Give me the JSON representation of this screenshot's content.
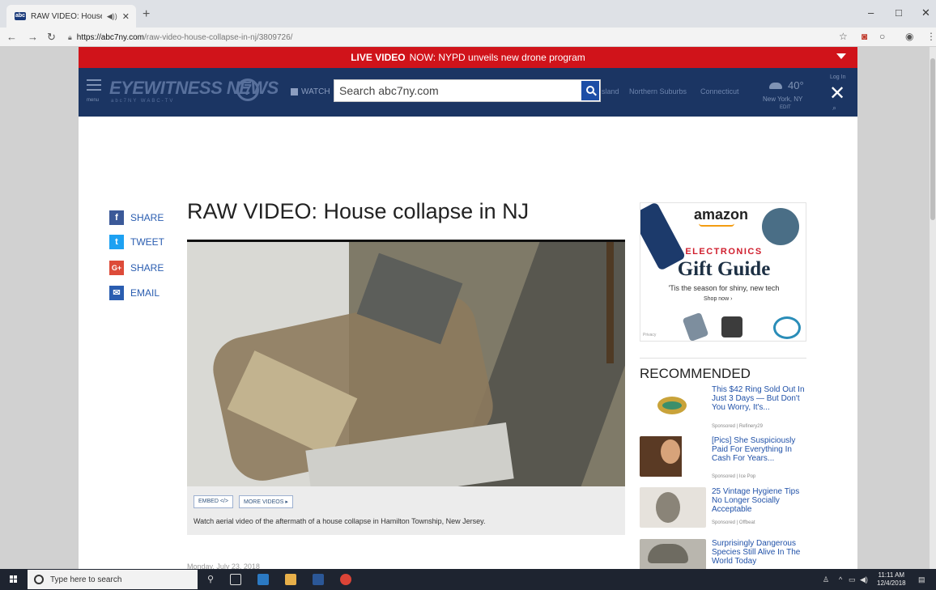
{
  "browser": {
    "tab_title": "RAW VIDEO: House collapse",
    "tab_audio": "◀))",
    "new_tab": "+",
    "url_host": "https://abc7ny.com",
    "url_path": "/raw-video-house-collapse-in-nj/3809726/",
    "window_controls": [
      "–",
      "□",
      "✕"
    ]
  },
  "live_bar": {
    "label": "LIVE VIDEO",
    "headline": "NOW: NYPD unveils new drone program",
    "color": "#d0131a"
  },
  "header": {
    "menu_label": "menu",
    "logo": "EYEWITNESS NEWS",
    "logo_badge": "7",
    "logo_sub": "abc7NY  WABC-TV",
    "watch_label": "WATCH",
    "search_placeholder": "Search abc7ny.com",
    "nav_links": [
      "sland",
      "Northern Suburbs",
      "Connecticut"
    ],
    "weather_temp": "40°",
    "weather_city": "New York, NY",
    "weather_edit": "EDIT",
    "login": "Log In",
    "color": "#1b3563"
  },
  "share": {
    "items": [
      {
        "label": "SHARE",
        "icon": "f",
        "color": "#3b5998"
      },
      {
        "label": "TWEET",
        "icon": "t",
        "color": "#1da1f2"
      },
      {
        "label": "SHARE",
        "icon": "G+",
        "color": "#dd4b39"
      },
      {
        "label": "EMAIL",
        "icon": "✉",
        "color": "#2a5db0"
      }
    ]
  },
  "article": {
    "title": "RAW VIDEO: House collapse in NJ",
    "embed_label": "EMBED </>",
    "more_videos_label": "MORE VIDEOS ▸",
    "caption": "Watch aerial video of the aftermath of a house collapse in Hamilton Township, New Jersey.",
    "date": "Monday, July 23, 2018"
  },
  "ad": {
    "brand": "amazon",
    "category": "ELECTRONICS",
    "headline": "Gift Guide",
    "subline": "'Tis the season for shiny, new tech",
    "cta": "Shop now ›",
    "privacy": "Privacy"
  },
  "recommended": {
    "title": "RECOMMENDED",
    "items": [
      {
        "text": "This $42 Ring Sold Out In Just 3 Days — But Don't You Worry, It's...",
        "sponsor": "Sponsored | Refinery29"
      },
      {
        "text": "[Pics] She Suspiciously Paid For Everything In Cash For Years...",
        "sponsor": "Sponsored | Ice Pop"
      },
      {
        "text": "25 Vintage Hygiene Tips No Longer Socially Acceptable",
        "sponsor": "Sponsored | Offbeat"
      },
      {
        "text": "Surprisingly Dangerous Species Still Alive In The World Today",
        "sponsor": ""
      }
    ]
  },
  "taskbar": {
    "search_placeholder": "Type here to search",
    "time": "11:11 AM",
    "date": "12/4/2018"
  }
}
